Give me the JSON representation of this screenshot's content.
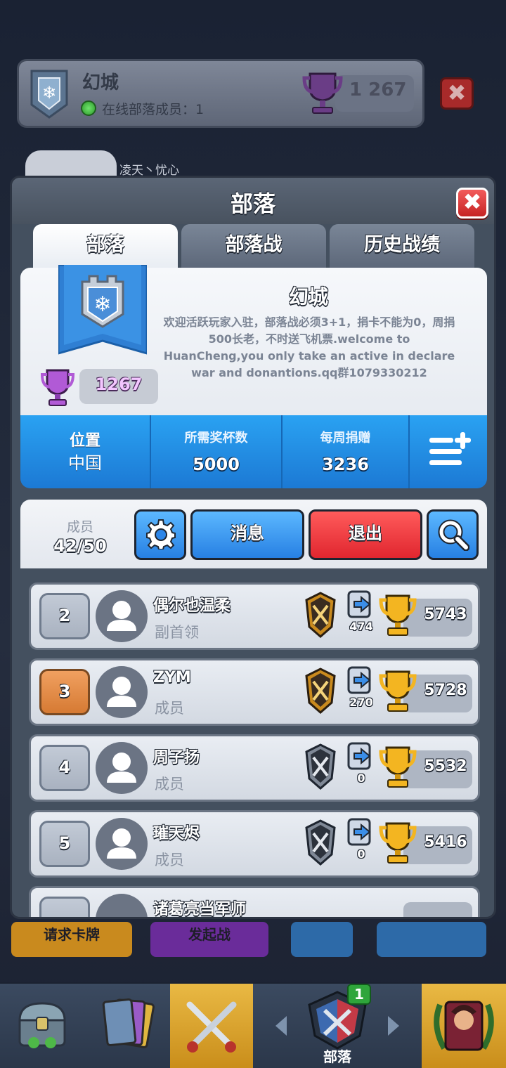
{
  "background": {
    "clan_name": "幻城",
    "online_text": "在线部落成员：1",
    "trophies": "1 267",
    "chat_sender": "凌天丶忧心",
    "buttons": {
      "request": "请求卡牌",
      "war": "发起战",
      "emote": "",
      "chat": ""
    }
  },
  "panel": {
    "title": "部落",
    "tabs": [
      "部落",
      "部落战",
      "历史战绩"
    ]
  },
  "clan": {
    "name": "幻城",
    "description": "欢迎活跃玩家入驻，部落战必须3+1，捐卡不能为0，周捐500长老，不时送飞机票.welcome to HuanCheng,you only take an active in declare war and donantions.qq群1079330212",
    "trophies": "1267"
  },
  "stats": {
    "location_label": "位置",
    "location_value": "中国",
    "required_label": "所需奖杯数",
    "required_value": "5000",
    "donations_label": "每周捐赠",
    "donations_value": "3236"
  },
  "members_header": {
    "label": "成员",
    "count": "42/50",
    "messages": "消息",
    "leave": "退出"
  },
  "members": [
    {
      "rank": "2",
      "name": "偶尔也温柔",
      "role": "副首领",
      "donations": "474",
      "trophies": "5743"
    },
    {
      "rank": "3",
      "name": "ZYM",
      "role": "成员",
      "donations": "270",
      "trophies": "5728"
    },
    {
      "rank": "4",
      "name": "周子扬",
      "role": "成员",
      "donations": "0",
      "trophies": "5532"
    },
    {
      "rank": "5",
      "name": "璀天烬",
      "role": "成员",
      "donations": "0",
      "trophies": "5416"
    },
    {
      "rank": "",
      "name": "诸葛亮当军师",
      "role": "",
      "donations": "",
      "trophies": ""
    }
  ],
  "nav": {
    "clan_label": "部落",
    "clan_badge": "1"
  }
}
